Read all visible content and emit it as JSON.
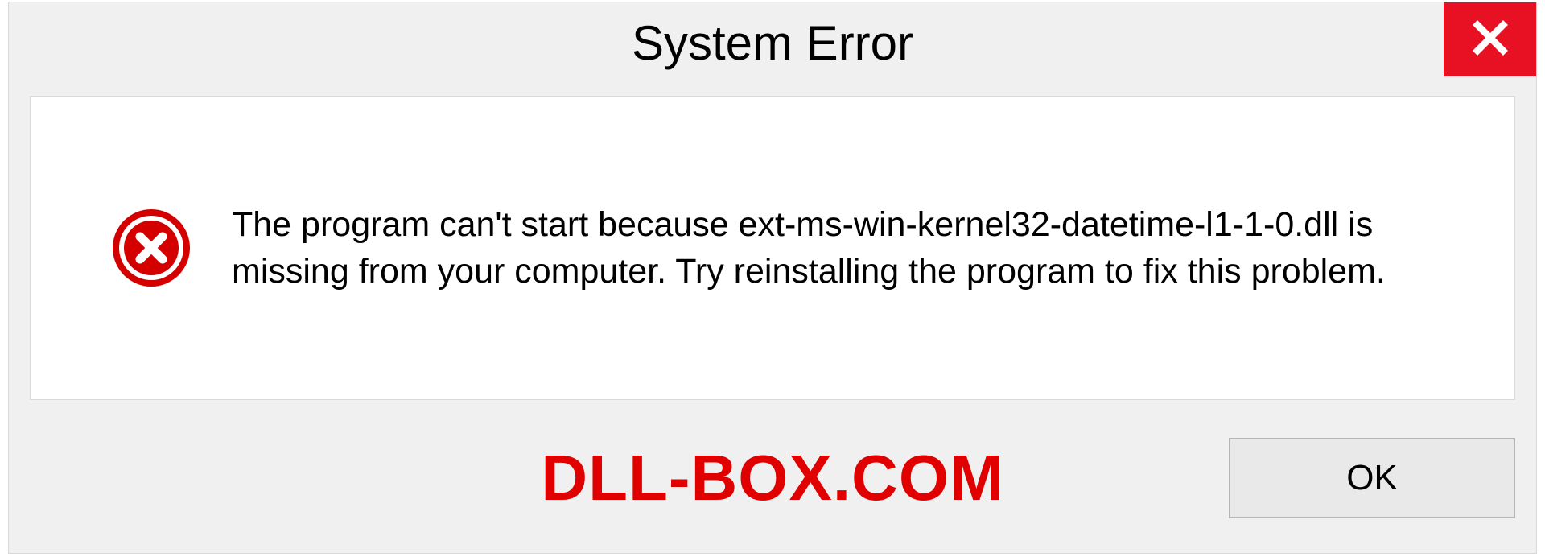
{
  "dialog": {
    "title": "System Error",
    "message": "The program can't start because ext-ms-win-kernel32-datetime-l1-1-0.dll is missing from your computer. Try reinstalling the program to fix this problem.",
    "ok_label": "OK"
  },
  "watermark": "DLL-BOX.COM"
}
